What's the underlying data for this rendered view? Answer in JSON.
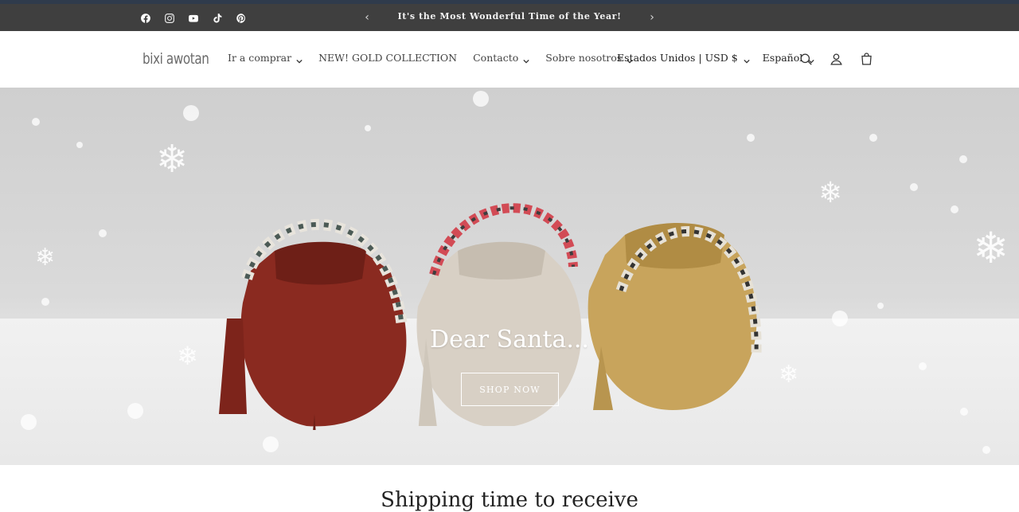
{
  "announcement": {
    "text": "It's the Most Wonderful Time of the Year!",
    "social": [
      "facebook-icon",
      "instagram-icon",
      "youtube-icon",
      "tiktok-icon",
      "pinterest-icon"
    ]
  },
  "header": {
    "logo": "bixi awotan",
    "nav": [
      {
        "label": "Ir a comprar",
        "dropdown": true
      },
      {
        "label": "NEW! GOLD COLLECTION",
        "dropdown": false
      },
      {
        "label": "Contacto",
        "dropdown": true
      },
      {
        "label": "Sobre nosotros",
        "dropdown": true
      }
    ],
    "country_currency": "Estados Unidos | USD $",
    "language": "Español",
    "icons": [
      "search-icon",
      "account-icon",
      "cart-icon"
    ]
  },
  "hero": {
    "title": "Dear Santa...",
    "button_label": "SHOP NOW"
  },
  "section": {
    "title": "Shipping time to receive"
  },
  "colors": {
    "announcement_bg": "#3f3f3f",
    "top_accent": "#2f3b4c",
    "bag_red": "#8a2a20",
    "bag_beige": "#d8d0c5",
    "bag_gold": "#c8a45c"
  }
}
